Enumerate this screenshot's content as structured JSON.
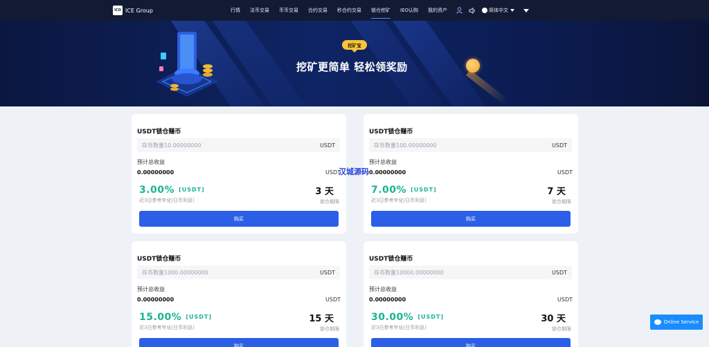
{
  "brand": {
    "logo_text": "ICO",
    "name": "ICE Group"
  },
  "nav": {
    "items": [
      "行情",
      "法币交易",
      "币币交易",
      "合约交易",
      "秒合约交易",
      "锁仓挖矿",
      "IEO认购",
      "我的资产"
    ],
    "active_index": 5
  },
  "header_tools": {
    "language": "简体中文"
  },
  "banner": {
    "badge": "挖矿宝",
    "title": "挖矿更简单 轻松领奖励"
  },
  "cards": [
    {
      "title": "USDT锁仓赚币",
      "input_placeholder": "存币数量10.00000000",
      "input_unit": "USDT",
      "est_label": "预计总收益",
      "est_value": "0.00000000",
      "est_unit": "USDT",
      "rate": "3.00%",
      "rate_unit": "[USDT]",
      "rate_desc": "近3日参考年化(日币利息)",
      "days": "3 天",
      "days_label": "锁仓期限",
      "buy_label": "购买"
    },
    {
      "title": "USDT锁仓赚币",
      "input_placeholder": "存币数量100.00000000",
      "input_unit": "USDT",
      "est_label": "预计总收益",
      "est_value": "0.00000000",
      "est_unit": "USDT",
      "rate": "7.00%",
      "rate_unit": "[USDT]",
      "rate_desc": "近3日参考年化(日币利息)",
      "days": "7 天",
      "days_label": "锁仓期限",
      "buy_label": "购买"
    },
    {
      "title": "USDT锁仓赚币",
      "input_placeholder": "存币数量1000.00000000",
      "input_unit": "USDT",
      "est_label": "预计总收益",
      "est_value": "0.00000000",
      "est_unit": "USDT",
      "rate": "15.00%",
      "rate_unit": "[USDT]",
      "rate_desc": "近3日参考年化(日币利息)",
      "days": "15 天",
      "days_label": "锁仓期限",
      "buy_label": "购买"
    },
    {
      "title": "USDT锁仓赚币",
      "input_placeholder": "存币数量10000.00000000",
      "input_unit": "USDT",
      "est_label": "预计总收益",
      "est_value": "0.00000000",
      "est_unit": "USDT",
      "rate": "30.00%",
      "rate_unit": "[USDT]",
      "rate_desc": "近3日参考年化(日币利息)",
      "days": "30 天",
      "days_label": "锁仓期限",
      "buy_label": "购买"
    }
  ],
  "watermark": "汉城源码",
  "online_service": "Online Service",
  "colors": {
    "nav_bg": "#131a34",
    "accent": "#2c5fe8",
    "rate_green": "#1ab394",
    "badge_yellow": "#f5c43a"
  }
}
